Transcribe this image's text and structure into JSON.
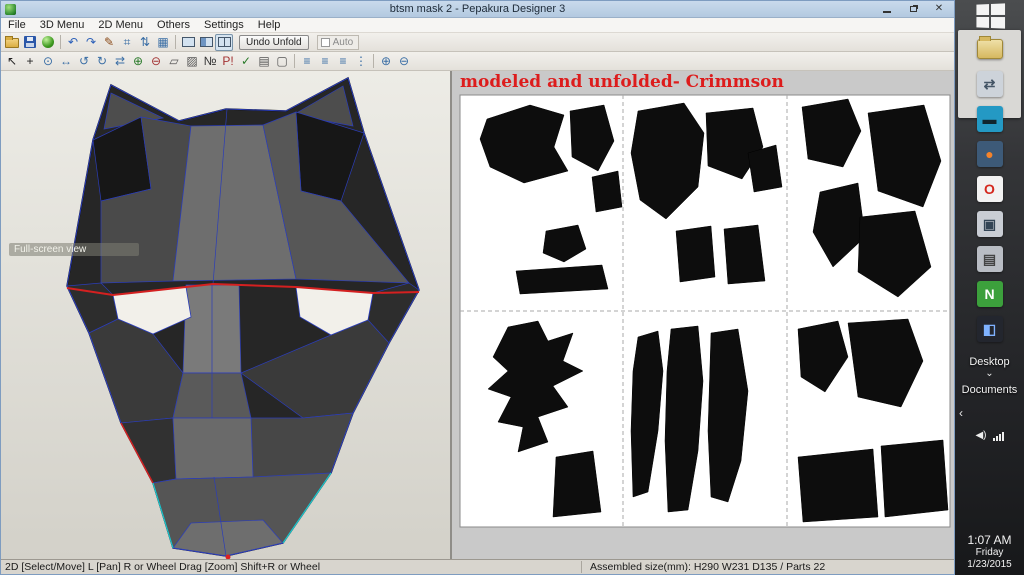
{
  "titlebar": {
    "title": "btsm mask 2 - Pepakura Designer 3",
    "window_controls": [
      "minimize",
      "restore",
      "close"
    ]
  },
  "menubar": {
    "items": [
      "File",
      "3D Menu",
      "2D Menu",
      "Others",
      "Settings",
      "Help"
    ]
  },
  "toolbar_main": {
    "icons": [
      {
        "name": "open-folder-icon",
        "type": "folder"
      },
      {
        "name": "save-icon",
        "type": "floppy"
      },
      {
        "name": "texture-view-icon",
        "type": "ball"
      },
      {
        "name": "sep",
        "type": "sep"
      },
      {
        "name": "undo-icon",
        "type": "glyph",
        "glyph": "↶",
        "color": "#2b5fb8"
      },
      {
        "name": "redo-icon",
        "type": "glyph",
        "glyph": "↷",
        "color": "#2b5fb8"
      },
      {
        "name": "pen-icon",
        "type": "glyph",
        "glyph": "✎",
        "color": "#8a4a18"
      },
      {
        "name": "measure-icon",
        "type": "glyph",
        "glyph": "⌗",
        "color": "#3a6ea5"
      },
      {
        "name": "updown-icon",
        "type": "glyph",
        "glyph": "⇅",
        "color": "#3a6ea5"
      },
      {
        "name": "table-icon",
        "type": "glyph",
        "glyph": "▦",
        "color": "#3a6ea5"
      },
      {
        "name": "sep",
        "type": "sep"
      },
      {
        "name": "view-3d-only-icon",
        "type": "monitor",
        "variant": "full"
      },
      {
        "name": "view-2d-only-icon",
        "type": "monitor",
        "variant": "half"
      },
      {
        "name": "view-split-icon",
        "type": "monitor",
        "variant": "split",
        "pressed": true
      }
    ],
    "undo_unfold_label": "Undo Unfold",
    "auto_label": "Auto"
  },
  "toolbar_2d": {
    "icons": [
      {
        "name": "select-icon",
        "glyph": "↖",
        "color": "#222"
      },
      {
        "name": "pan-icon",
        "glyph": "+",
        "color": "#222"
      },
      {
        "name": "zoom-icon",
        "glyph": "⊙",
        "color": "#3a6ea5"
      },
      {
        "name": "move-part-icon",
        "glyph": "↔",
        "color": "#3a6ea5"
      },
      {
        "name": "rotate-ccw-icon",
        "glyph": "↺",
        "color": "#3a6ea5"
      },
      {
        "name": "rotate-cw-icon",
        "glyph": "↻",
        "color": "#3a6ea5"
      },
      {
        "name": "flip-part-icon",
        "glyph": "⇄",
        "color": "#3a6ea5"
      },
      {
        "name": "join-edge-icon",
        "glyph": "⊕",
        "color": "#2a7a2a"
      },
      {
        "name": "split-edge-icon",
        "glyph": "⊖",
        "color": "#a33333"
      },
      {
        "name": "flap-icon",
        "glyph": "▱",
        "color": "#555"
      },
      {
        "name": "edge-color-icon",
        "glyph": "▨",
        "color": "#555"
      },
      {
        "name": "edge-number-icon",
        "glyph": "№",
        "color": "#333"
      },
      {
        "name": "parts-check-icon",
        "glyph": "P!",
        "color": "#a33333"
      },
      {
        "name": "validate-icon",
        "glyph": "✓",
        "color": "#2a7a2a"
      },
      {
        "name": "print-icon",
        "glyph": "▤",
        "color": "#555"
      },
      {
        "name": "sheet-icon",
        "glyph": "▢",
        "color": "#555"
      },
      {
        "name": "sep"
      },
      {
        "name": "align-left-icon",
        "glyph": "≡",
        "color": "#3a6ea5"
      },
      {
        "name": "align-center-icon",
        "glyph": "≡",
        "color": "#3a6ea5"
      },
      {
        "name": "align-right-icon",
        "glyph": "≡",
        "color": "#3a6ea5"
      },
      {
        "name": "distribute-icon",
        "glyph": "⋮",
        "color": "#3a6ea5"
      },
      {
        "name": "sep"
      },
      {
        "name": "zoom-in-icon",
        "glyph": "⊕",
        "color": "#3a6ea5"
      },
      {
        "name": "zoom-out-icon",
        "glyph": "⊖",
        "color": "#3a6ea5"
      }
    ]
  },
  "viewport_3d": {
    "tooltip": "Full-screen view"
  },
  "viewport_2d": {
    "annotation": "modeled and unfolded- Crimmson"
  },
  "statusbar": {
    "mode_text": "2D [Select/Move] L [Pan] R or Wheel Drag [Zoom] Shift+R or Wheel",
    "size_text": "Assembled size(mm): H290 W231 D135 / Parts 22"
  },
  "desktop": {
    "icons": [
      {
        "name": "folder-icon",
        "type": "folder"
      },
      {
        "name": "network-share-icon",
        "glyph": "⇄",
        "bg": "#cdd3da",
        "fg": "#445566"
      },
      {
        "name": "chat-app-icon",
        "glyph": "▬",
        "bg": "#2499c4",
        "fg": "#10262e"
      },
      {
        "name": "blender-icon",
        "glyph": "●",
        "bg": "#3d5a78",
        "fg": "#f5832a"
      },
      {
        "name": "opera-icon",
        "glyph": "O",
        "bg": "#f2f2f2",
        "fg": "#d4281e"
      },
      {
        "name": "computer-icon",
        "glyph": "▣",
        "bg": "#c9cdd4",
        "fg": "#334455"
      },
      {
        "name": "printer-icon",
        "glyph": "▤",
        "bg": "#b9bdc4",
        "fg": "#444"
      },
      {
        "name": "notes-app-icon",
        "glyph": "N",
        "bg": "#3ca03c",
        "fg": "#ffffff"
      },
      {
        "name": "utility-app-icon",
        "glyph": "◧",
        "bg": "#23262e",
        "fg": "#7fb2ff"
      }
    ],
    "desktop_label": "Desktop",
    "documents_label": "Documents",
    "clock": {
      "time": "1:07 AM",
      "day": "Friday",
      "date": "1/23/2015"
    }
  },
  "colors": {
    "annotation_red": "#dd1c1c",
    "edge_blue": "#2b3db8",
    "edge_red": "#d42020",
    "edge_cyan": "#18c8c8",
    "piece_black": "#0d0d0d"
  }
}
